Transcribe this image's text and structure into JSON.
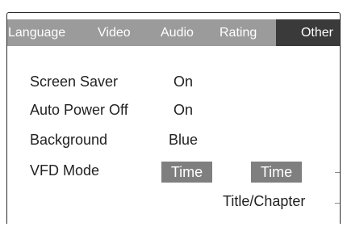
{
  "tabs": [
    {
      "label": "Language"
    },
    {
      "label": "Video"
    },
    {
      "label": "Audio"
    },
    {
      "label": "Rating"
    },
    {
      "label": "Other",
      "active": true
    }
  ],
  "settings": {
    "screen_saver": {
      "label": "Screen Saver",
      "value": "On"
    },
    "auto_power_off": {
      "label": "Auto Power Off",
      "value": "On"
    },
    "background": {
      "label": "Background",
      "value": "Blue"
    },
    "vfd_mode": {
      "label": "VFD Mode",
      "value": "Time",
      "options": [
        "Time",
        "Title/Chapter"
      ]
    }
  },
  "colors": {
    "tabbar": "#9b9b9b",
    "active_tab": "#3a3a3a",
    "selected_option": "#7f7f7f"
  }
}
